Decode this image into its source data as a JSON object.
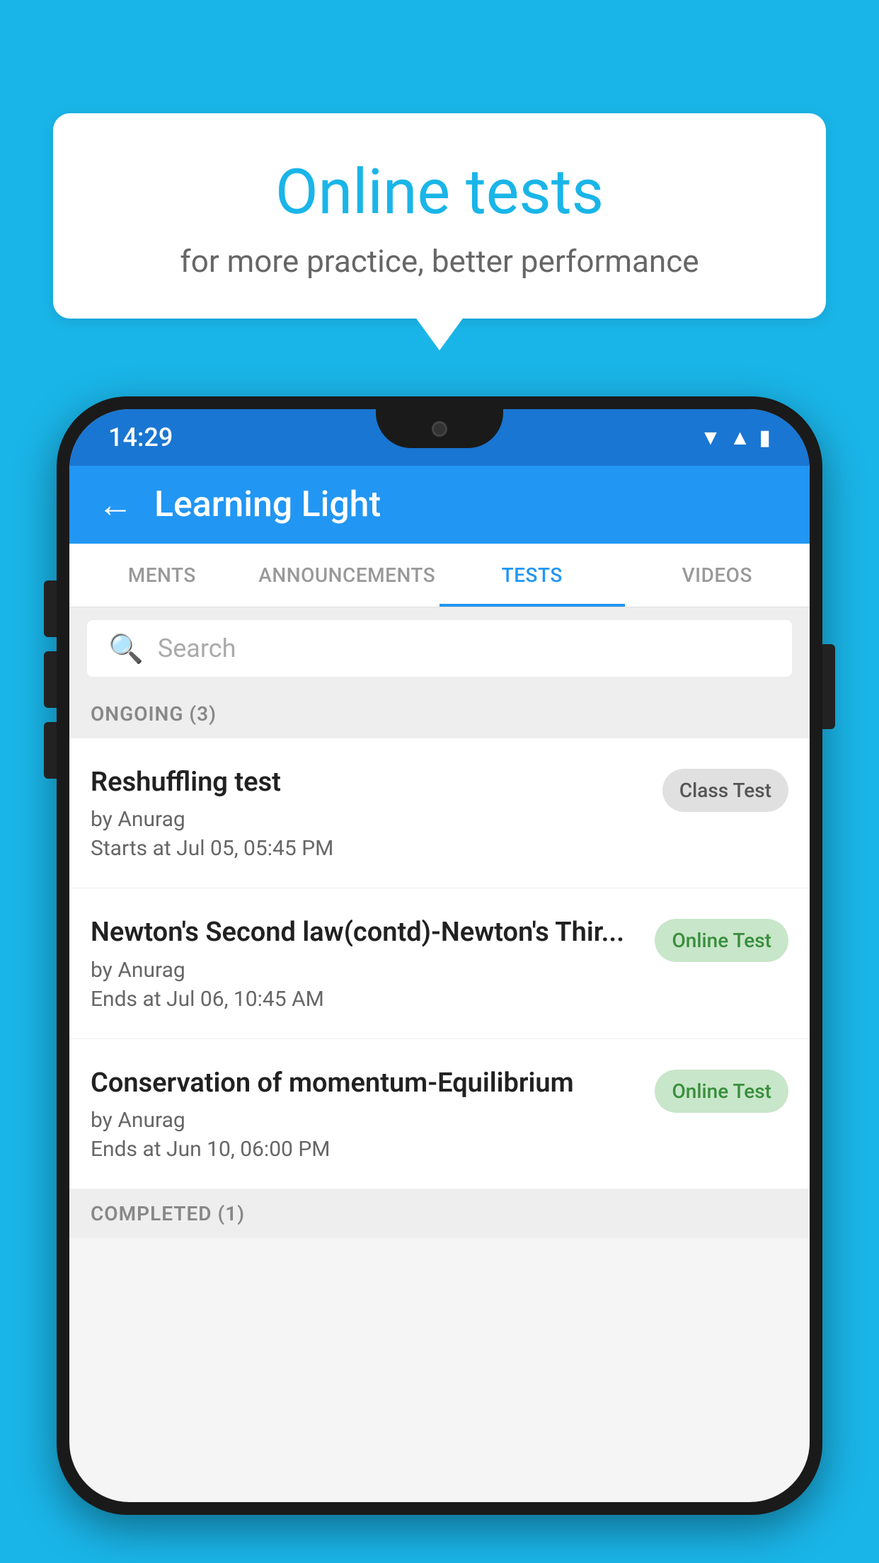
{
  "background_color": "#1ab5e8",
  "bubble": {
    "title": "Online tests",
    "subtitle": "for more practice, better performance"
  },
  "status_bar": {
    "time": "14:29",
    "icons": [
      "wifi",
      "signal",
      "battery"
    ]
  },
  "app_bar": {
    "title": "Learning Light",
    "back_label": "←"
  },
  "tabs": [
    {
      "label": "MENTS",
      "active": false
    },
    {
      "label": "ANNOUNCEMENTS",
      "active": false
    },
    {
      "label": "TESTS",
      "active": true
    },
    {
      "label": "VIDEOS",
      "active": false
    }
  ],
  "search": {
    "placeholder": "Search"
  },
  "sections": [
    {
      "header": "ONGOING (3)",
      "items": [
        {
          "name": "Reshuffling test",
          "author": "by Anurag",
          "date": "Starts at  Jul 05, 05:45 PM",
          "badge": "Class Test",
          "badge_type": "class"
        },
        {
          "name": "Newton's Second law(contd)-Newton's Thir...",
          "author": "by Anurag",
          "date": "Ends at  Jul 06, 10:45 AM",
          "badge": "Online Test",
          "badge_type": "online"
        },
        {
          "name": "Conservation of momentum-Equilibrium",
          "author": "by Anurag",
          "date": "Ends at  Jun 10, 06:00 PM",
          "badge": "Online Test",
          "badge_type": "online"
        }
      ]
    }
  ],
  "completed_header": "COMPLETED (1)"
}
